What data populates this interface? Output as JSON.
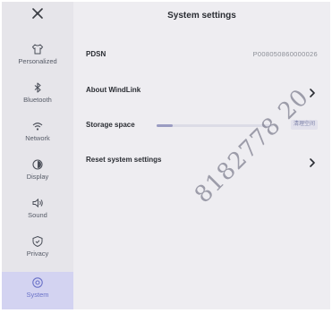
{
  "header": {
    "title": "System settings"
  },
  "sidebar": {
    "logo_icon": "windmill-logo-icon",
    "items": [
      {
        "label": "Personalized",
        "icon": "shirt-icon"
      },
      {
        "label": "Bluetooth",
        "icon": "bluetooth-icon"
      },
      {
        "label": "Network",
        "icon": "wifi-icon"
      },
      {
        "label": "Display",
        "icon": "brightness-icon"
      },
      {
        "label": "Sound",
        "icon": "speaker-icon"
      },
      {
        "label": "Privacy",
        "icon": "shield-icon"
      },
      {
        "label": "System",
        "icon": "settings-circle-icon",
        "active": true
      }
    ]
  },
  "settings": {
    "pdsn_label": "PDSN",
    "pdsn_value": "P008050860000026",
    "about_label": "About WindLink",
    "storage_label": "Storage space",
    "storage_used_fraction": 0.14,
    "storage_button": "清理空间",
    "reset_label": "Reset system settings"
  },
  "watermark": "8182778 20",
  "colors": {
    "screen_background": "#eeedf1",
    "sidebar_background": "#e6e5ea",
    "active_item_background": "#d3d3f1",
    "accent": "#6a72c8",
    "text_primary": "#2a2d33",
    "text_secondary": "#8b8e96"
  }
}
